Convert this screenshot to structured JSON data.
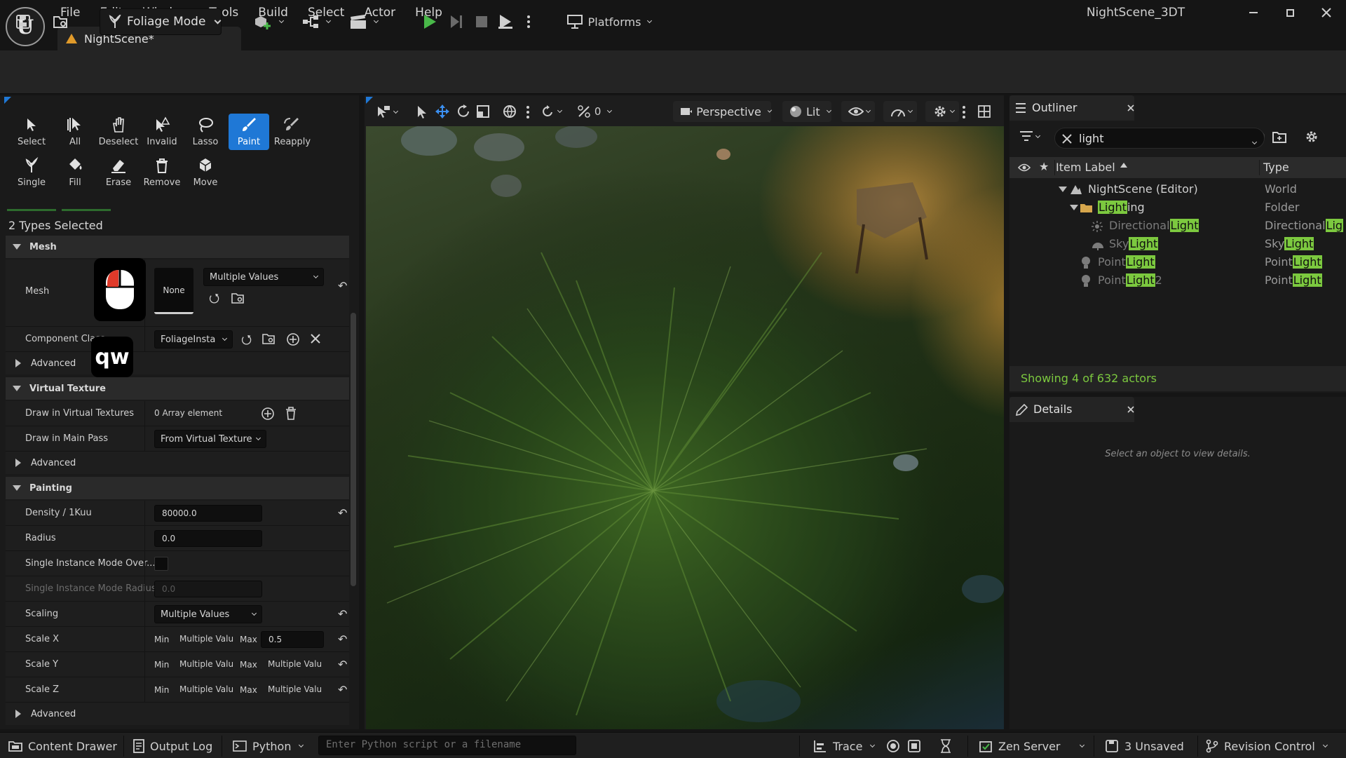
{
  "window": {
    "project_name": "NightScene_3DT",
    "doc_tab": "NightScene*",
    "logo_letter": "U"
  },
  "menu": [
    "File",
    "Edit",
    "Window",
    "Tools",
    "Build",
    "Select",
    "Actor",
    "Help"
  ],
  "toolbar": {
    "mode_label": "Foliage Mode",
    "platforms_label": "Platforms"
  },
  "foliage_tools": {
    "row1": [
      "Select",
      "All",
      "Deselect",
      "Invalid",
      "Lasso",
      "Paint",
      "Reapply"
    ],
    "row2": [
      "Single",
      "Fill",
      "Erase",
      "Remove",
      "Move"
    ],
    "active": "Paint"
  },
  "details_panel": {
    "types_selected": "2 Types Selected",
    "mesh_section": "Mesh",
    "mesh_label": "Mesh",
    "mesh_thumb": "None",
    "mesh_value": "Multiple Values",
    "component_class_label": "Component Class",
    "component_class_value": "FoliageInsta",
    "advanced": "Advanced",
    "virtual_texture_section": "Virtual Texture",
    "draw_in_vt_label": "Draw in Virtual Textures",
    "draw_in_vt_value": "0 Array element",
    "draw_main_pass_label": "Draw in Main Pass",
    "draw_main_pass_value": "From Virtual Texture",
    "painting_section": "Painting",
    "density_label": "Density / 1Kuu",
    "density_value": "80000.0",
    "radius_label": "Radius",
    "radius_value": "0.0",
    "single_mode_label": "Single Instance Mode Over...",
    "single_radius_label": "Single Instance Mode Radius",
    "single_radius_value": "0.0",
    "scaling_label": "Scaling",
    "scaling_value": "Multiple Values",
    "scale_x_label": "Scale X",
    "scale_y_label": "Scale Y",
    "scale_z_label": "Scale Z",
    "min": "Min",
    "max": "Max",
    "multiple_vals": "Multiple Valu",
    "scale_x_max": "0.5"
  },
  "viewport": {
    "zero_label": "0",
    "perspective": "Perspective",
    "lit": "Lit"
  },
  "outliner": {
    "title": "Outliner",
    "search_value": "light",
    "col_label": "Item Label",
    "col_type": "Type",
    "rows": [
      {
        "pre": "NightScene (Editor)",
        "hl": "",
        "post": "",
        "type_pre": "World",
        "type_hl": "",
        "type_post": ""
      },
      {
        "pre": "",
        "hl": "Light",
        "post": "ing",
        "type_pre": "Folder",
        "type_hl": "",
        "type_post": ""
      },
      {
        "pre": "Directional",
        "hl": "Light",
        "post": "",
        "type_pre": "Directional",
        "type_hl": "Lig",
        "type_post": ""
      },
      {
        "pre": "Sky",
        "hl": "Light",
        "post": "",
        "type_pre": "Sky",
        "type_hl": "Light",
        "type_post": ""
      },
      {
        "pre": "Point",
        "hl": "Light",
        "post": "",
        "type_pre": "Point",
        "type_hl": "Light",
        "type_post": ""
      },
      {
        "pre": "Point",
        "hl": "Light",
        "post": "2",
        "type_pre": "Point",
        "type_hl": "Light",
        "type_post": ""
      }
    ],
    "showing": "Showing 4 of 632 actors"
  },
  "details": {
    "title": "Details",
    "empty_message": "Select an object to view details."
  },
  "overlay": {
    "keys": "qw"
  },
  "statusbar": {
    "content_drawer": "Content Drawer",
    "output_log": "Output Log",
    "python": "Python",
    "python_placeholder": "Enter Python script or a filename",
    "trace": "Trace",
    "zen_server": "Zen Server",
    "unsaved": "3 Unsaved",
    "revision_control": "Revision Control"
  },
  "colors": {
    "accent": "#1f78d6",
    "highlight": "#7cc93f",
    "play": "#49b849"
  }
}
